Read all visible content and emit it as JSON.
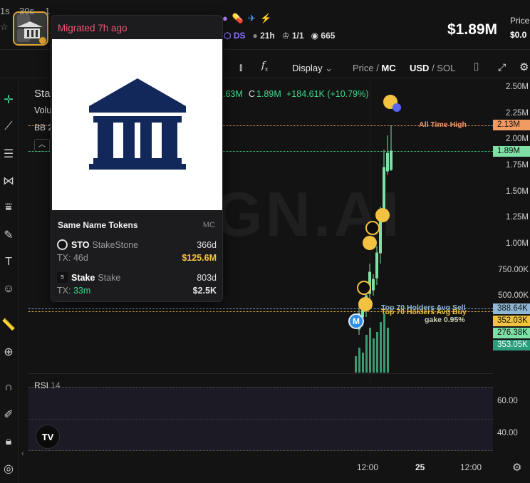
{
  "header": {
    "stats": {
      "ds_label": "DS",
      "age": "21h",
      "ratio": "1/1",
      "views": "665"
    },
    "price": "$1.89M",
    "price_label": "Price",
    "price_sol": "$0.0"
  },
  "toolbar": {
    "timeframes": [
      "1s",
      "30s",
      "1"
    ],
    "display_label": "Display",
    "price_label": "Price",
    "mc_label": "MC",
    "usd_label": "USD",
    "sol_label": "SOL"
  },
  "chart": {
    "watermark": "GN.AI",
    "ohlc_text": ".63M",
    "close_label": "C",
    "close_value": "1.89M",
    "change_text": "+184.61K (+10.79%)",
    "legend_left": [
      "Sta",
      "Volu",
      "BB 2"
    ],
    "ath_label": "All Time High",
    "holders_sell_label": "Top 70 Holders Avg Sell",
    "holders_buy_label": "Top 70 Holders Avg Buy",
    "gake_label": "gake 0.95%",
    "marker_m": "M",
    "y_ticks": [
      "2.50M",
      "2.25M",
      "2.00M",
      "1.75M",
      "1.50M",
      "1.25M",
      "1.00M",
      "750.00K",
      "500.00K"
    ],
    "price_tags": [
      {
        "value": "2.13M",
        "color": "#f19a62"
      },
      {
        "value": "1.89M",
        "color": "#7fe0a6"
      },
      {
        "value": "388.64K",
        "color": "#8fb8d6"
      },
      {
        "value": "352.03K",
        "color": "#f2c240"
      },
      {
        "value": "276.38K",
        "color": "#7fe0a6"
      },
      {
        "value": "353.05K",
        "color": "#2a9d7d"
      }
    ]
  },
  "rsi": {
    "label": "RSI",
    "period": "14",
    "ticks": [
      "60.00",
      "40.00"
    ]
  },
  "x_axis": [
    "12:00",
    "25",
    "12:00"
  ],
  "popup": {
    "title": "Migrated 7h ago",
    "same_name_title": "Same Name Tokens",
    "mc_header": "MC",
    "tokens": [
      {
        "symbol": "STO",
        "name": "StakeStone",
        "age": "366d",
        "tx_label": "TX:",
        "tx": "46d",
        "mc": "$125.6M",
        "mc_color": "#f2c240"
      },
      {
        "symbol": "Stake",
        "name": "Stake",
        "age": "803d",
        "tx_label": "TX:",
        "tx": "33m",
        "mc": "$2.5K",
        "mc_color": "#e8e8e8"
      }
    ]
  },
  "colors": {
    "accent_green": "#3fd68a",
    "ath_orange": "#f19a62",
    "bank_navy": "#13285a",
    "popup_title_red": "#ef5776"
  }
}
